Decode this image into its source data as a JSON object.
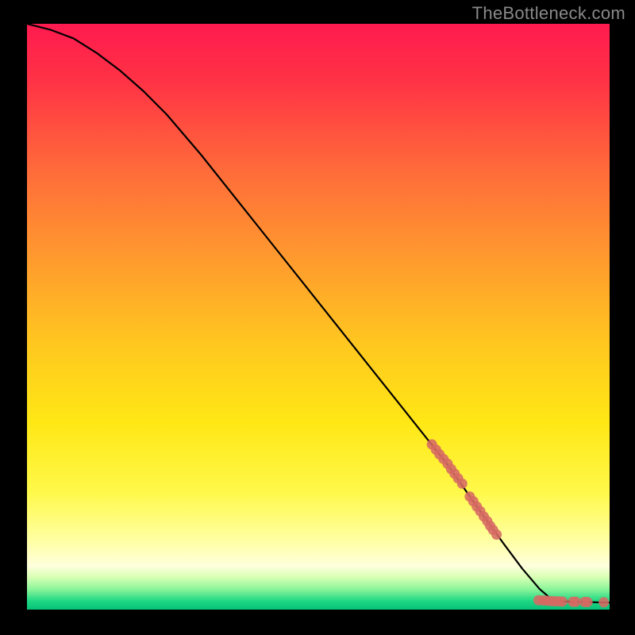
{
  "watermark": "TheBottleneck.com",
  "chart_data": {
    "type": "line",
    "title": "",
    "xlabel": "",
    "ylabel": "",
    "xlim": [
      0,
      100
    ],
    "ylim": [
      0,
      100
    ],
    "grid": false,
    "legend": false,
    "series": [
      {
        "name": "curve",
        "style": "line",
        "color": "#000000",
        "x": [
          0,
          4,
          8,
          12,
          16,
          20,
          24,
          30,
          36,
          42,
          48,
          54,
          60,
          66,
          72,
          78,
          82,
          85,
          88,
          90,
          92,
          95,
          100
        ],
        "y": [
          100,
          99,
          97.5,
          95,
          92,
          88.5,
          84.5,
          77.5,
          70,
          62.5,
          55,
          47.5,
          40,
          32.5,
          25,
          16.5,
          11,
          7,
          3.5,
          1.8,
          1.4,
          1.3,
          1.2
        ]
      },
      {
        "name": "marker-cluster-upper",
        "style": "scatter",
        "color": "#d66a63",
        "x": [
          69.5,
          70.2,
          70.8,
          71.5,
          72.2,
          72.8,
          73.4,
          74.0,
          74.7,
          76.0,
          76.6,
          77.2,
          77.8,
          78.4,
          79.0,
          79.5,
          80.0,
          80.6
        ],
        "y": [
          28.2,
          27.3,
          26.5,
          25.7,
          24.9,
          24.0,
          23.2,
          22.4,
          21.5,
          19.3,
          18.5,
          17.6,
          16.8,
          15.9,
          15.1,
          14.3,
          13.6,
          12.8
        ]
      },
      {
        "name": "marker-cluster-lower",
        "style": "scatter",
        "color": "#d66a63",
        "x": [
          87.8,
          88.6,
          89.3,
          90.0,
          90.6,
          91.3,
          91.9,
          93.7,
          94.2,
          95.7,
          96.2,
          99.0
        ],
        "y": [
          1.6,
          1.55,
          1.5,
          1.45,
          1.42,
          1.4,
          1.38,
          1.34,
          1.33,
          1.3,
          1.29,
          1.25
        ]
      }
    ],
    "background": {
      "type": "vertical-gradient",
      "stops": [
        {
          "pos": 0.0,
          "color": "#ff1a4f"
        },
        {
          "pos": 0.1,
          "color": "#ff3345"
        },
        {
          "pos": 0.25,
          "color": "#ff6b3a"
        },
        {
          "pos": 0.4,
          "color": "#ff9a2e"
        },
        {
          "pos": 0.55,
          "color": "#ffc81f"
        },
        {
          "pos": 0.68,
          "color": "#ffe715"
        },
        {
          "pos": 0.8,
          "color": "#fff94a"
        },
        {
          "pos": 0.88,
          "color": "#ffffa0"
        },
        {
          "pos": 0.925,
          "color": "#ffffdc"
        },
        {
          "pos": 0.945,
          "color": "#d7ffb4"
        },
        {
          "pos": 0.965,
          "color": "#8cf59a"
        },
        {
          "pos": 0.985,
          "color": "#1fd884"
        },
        {
          "pos": 1.0,
          "color": "#06c179"
        }
      ]
    }
  }
}
